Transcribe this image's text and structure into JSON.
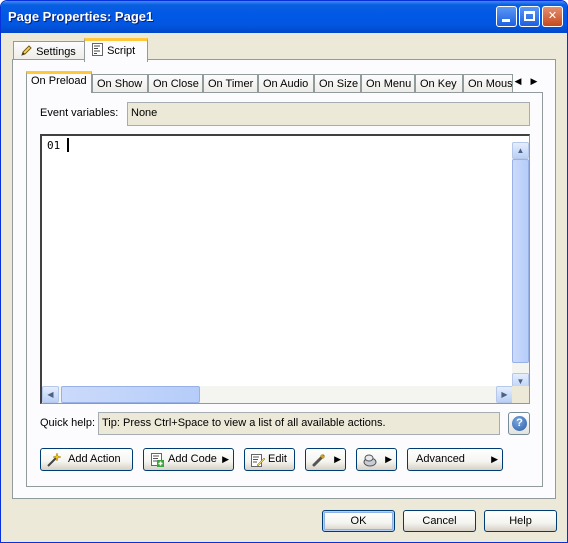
{
  "window": {
    "title": "Page Properties: Page1"
  },
  "outer_tabs": [
    {
      "label": "Settings",
      "icon": "pencil-icon"
    },
    {
      "label": "Script",
      "icon": "script-icon",
      "active": true
    }
  ],
  "event_tabs": [
    {
      "label": "On Preload",
      "active": true
    },
    {
      "label": "On Show"
    },
    {
      "label": "On Close"
    },
    {
      "label": "On Timer"
    },
    {
      "label": "On Audio"
    },
    {
      "label": "On Size"
    },
    {
      "label": "On Menu"
    },
    {
      "label": "On Key"
    },
    {
      "label": "On Mous"
    }
  ],
  "event_variables": {
    "label": "Event variables:",
    "value": "None"
  },
  "editor": {
    "line_number": "01"
  },
  "quick_help": {
    "label": "Quick help:",
    "text": "Tip: Press Ctrl+Space to view a list of all available actions."
  },
  "toolbar": {
    "add_action": "Add Action",
    "add_code": "Add Code",
    "edit": "Edit",
    "advanced": "Advanced"
  },
  "footer": {
    "ok": "OK",
    "cancel": "Cancel",
    "help": "Help"
  }
}
